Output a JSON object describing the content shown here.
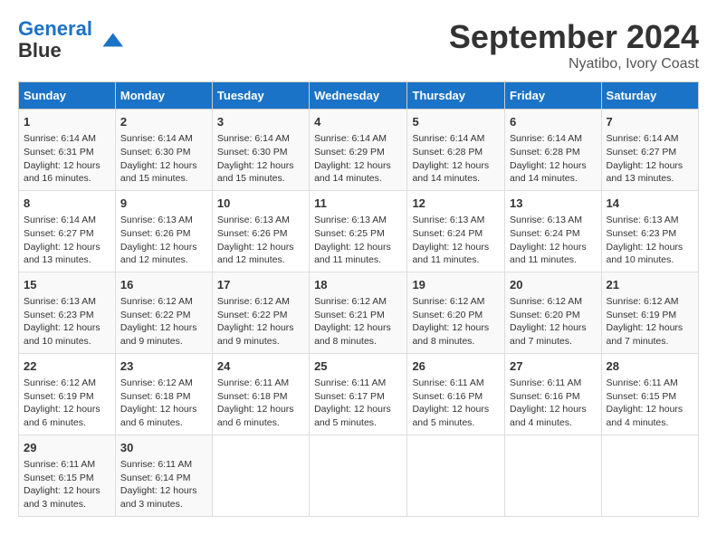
{
  "header": {
    "logo_line1": "General",
    "logo_line2": "Blue",
    "month_title": "September 2024",
    "subtitle": "Nyatibo, Ivory Coast"
  },
  "weekdays": [
    "Sunday",
    "Monday",
    "Tuesday",
    "Wednesday",
    "Thursday",
    "Friday",
    "Saturday"
  ],
  "weeks": [
    [
      {
        "day": "1",
        "lines": [
          "Sunrise: 6:14 AM",
          "Sunset: 6:31 PM",
          "Daylight: 12 hours",
          "and 16 minutes."
        ]
      },
      {
        "day": "2",
        "lines": [
          "Sunrise: 6:14 AM",
          "Sunset: 6:30 PM",
          "Daylight: 12 hours",
          "and 15 minutes."
        ]
      },
      {
        "day": "3",
        "lines": [
          "Sunrise: 6:14 AM",
          "Sunset: 6:30 PM",
          "Daylight: 12 hours",
          "and 15 minutes."
        ]
      },
      {
        "day": "4",
        "lines": [
          "Sunrise: 6:14 AM",
          "Sunset: 6:29 PM",
          "Daylight: 12 hours",
          "and 14 minutes."
        ]
      },
      {
        "day": "5",
        "lines": [
          "Sunrise: 6:14 AM",
          "Sunset: 6:28 PM",
          "Daylight: 12 hours",
          "and 14 minutes."
        ]
      },
      {
        "day": "6",
        "lines": [
          "Sunrise: 6:14 AM",
          "Sunset: 6:28 PM",
          "Daylight: 12 hours",
          "and 14 minutes."
        ]
      },
      {
        "day": "7",
        "lines": [
          "Sunrise: 6:14 AM",
          "Sunset: 6:27 PM",
          "Daylight: 12 hours",
          "and 13 minutes."
        ]
      }
    ],
    [
      {
        "day": "8",
        "lines": [
          "Sunrise: 6:14 AM",
          "Sunset: 6:27 PM",
          "Daylight: 12 hours",
          "and 13 minutes."
        ]
      },
      {
        "day": "9",
        "lines": [
          "Sunrise: 6:13 AM",
          "Sunset: 6:26 PM",
          "Daylight: 12 hours",
          "and 12 minutes."
        ]
      },
      {
        "day": "10",
        "lines": [
          "Sunrise: 6:13 AM",
          "Sunset: 6:26 PM",
          "Daylight: 12 hours",
          "and 12 minutes."
        ]
      },
      {
        "day": "11",
        "lines": [
          "Sunrise: 6:13 AM",
          "Sunset: 6:25 PM",
          "Daylight: 12 hours",
          "and 11 minutes."
        ]
      },
      {
        "day": "12",
        "lines": [
          "Sunrise: 6:13 AM",
          "Sunset: 6:24 PM",
          "Daylight: 12 hours",
          "and 11 minutes."
        ]
      },
      {
        "day": "13",
        "lines": [
          "Sunrise: 6:13 AM",
          "Sunset: 6:24 PM",
          "Daylight: 12 hours",
          "and 11 minutes."
        ]
      },
      {
        "day": "14",
        "lines": [
          "Sunrise: 6:13 AM",
          "Sunset: 6:23 PM",
          "Daylight: 12 hours",
          "and 10 minutes."
        ]
      }
    ],
    [
      {
        "day": "15",
        "lines": [
          "Sunrise: 6:13 AM",
          "Sunset: 6:23 PM",
          "Daylight: 12 hours",
          "and 10 minutes."
        ]
      },
      {
        "day": "16",
        "lines": [
          "Sunrise: 6:12 AM",
          "Sunset: 6:22 PM",
          "Daylight: 12 hours",
          "and 9 minutes."
        ]
      },
      {
        "day": "17",
        "lines": [
          "Sunrise: 6:12 AM",
          "Sunset: 6:22 PM",
          "Daylight: 12 hours",
          "and 9 minutes."
        ]
      },
      {
        "day": "18",
        "lines": [
          "Sunrise: 6:12 AM",
          "Sunset: 6:21 PM",
          "Daylight: 12 hours",
          "and 8 minutes."
        ]
      },
      {
        "day": "19",
        "lines": [
          "Sunrise: 6:12 AM",
          "Sunset: 6:20 PM",
          "Daylight: 12 hours",
          "and 8 minutes."
        ]
      },
      {
        "day": "20",
        "lines": [
          "Sunrise: 6:12 AM",
          "Sunset: 6:20 PM",
          "Daylight: 12 hours",
          "and 7 minutes."
        ]
      },
      {
        "day": "21",
        "lines": [
          "Sunrise: 6:12 AM",
          "Sunset: 6:19 PM",
          "Daylight: 12 hours",
          "and 7 minutes."
        ]
      }
    ],
    [
      {
        "day": "22",
        "lines": [
          "Sunrise: 6:12 AM",
          "Sunset: 6:19 PM",
          "Daylight: 12 hours",
          "and 6 minutes."
        ]
      },
      {
        "day": "23",
        "lines": [
          "Sunrise: 6:12 AM",
          "Sunset: 6:18 PM",
          "Daylight: 12 hours",
          "and 6 minutes."
        ]
      },
      {
        "day": "24",
        "lines": [
          "Sunrise: 6:11 AM",
          "Sunset: 6:18 PM",
          "Daylight: 12 hours",
          "and 6 minutes."
        ]
      },
      {
        "day": "25",
        "lines": [
          "Sunrise: 6:11 AM",
          "Sunset: 6:17 PM",
          "Daylight: 12 hours",
          "and 5 minutes."
        ]
      },
      {
        "day": "26",
        "lines": [
          "Sunrise: 6:11 AM",
          "Sunset: 6:16 PM",
          "Daylight: 12 hours",
          "and 5 minutes."
        ]
      },
      {
        "day": "27",
        "lines": [
          "Sunrise: 6:11 AM",
          "Sunset: 6:16 PM",
          "Daylight: 12 hours",
          "and 4 minutes."
        ]
      },
      {
        "day": "28",
        "lines": [
          "Sunrise: 6:11 AM",
          "Sunset: 6:15 PM",
          "Daylight: 12 hours",
          "and 4 minutes."
        ]
      }
    ],
    [
      {
        "day": "29",
        "lines": [
          "Sunrise: 6:11 AM",
          "Sunset: 6:15 PM",
          "Daylight: 12 hours",
          "and 3 minutes."
        ]
      },
      {
        "day": "30",
        "lines": [
          "Sunrise: 6:11 AM",
          "Sunset: 6:14 PM",
          "Daylight: 12 hours",
          "and 3 minutes."
        ]
      },
      null,
      null,
      null,
      null,
      null
    ]
  ]
}
